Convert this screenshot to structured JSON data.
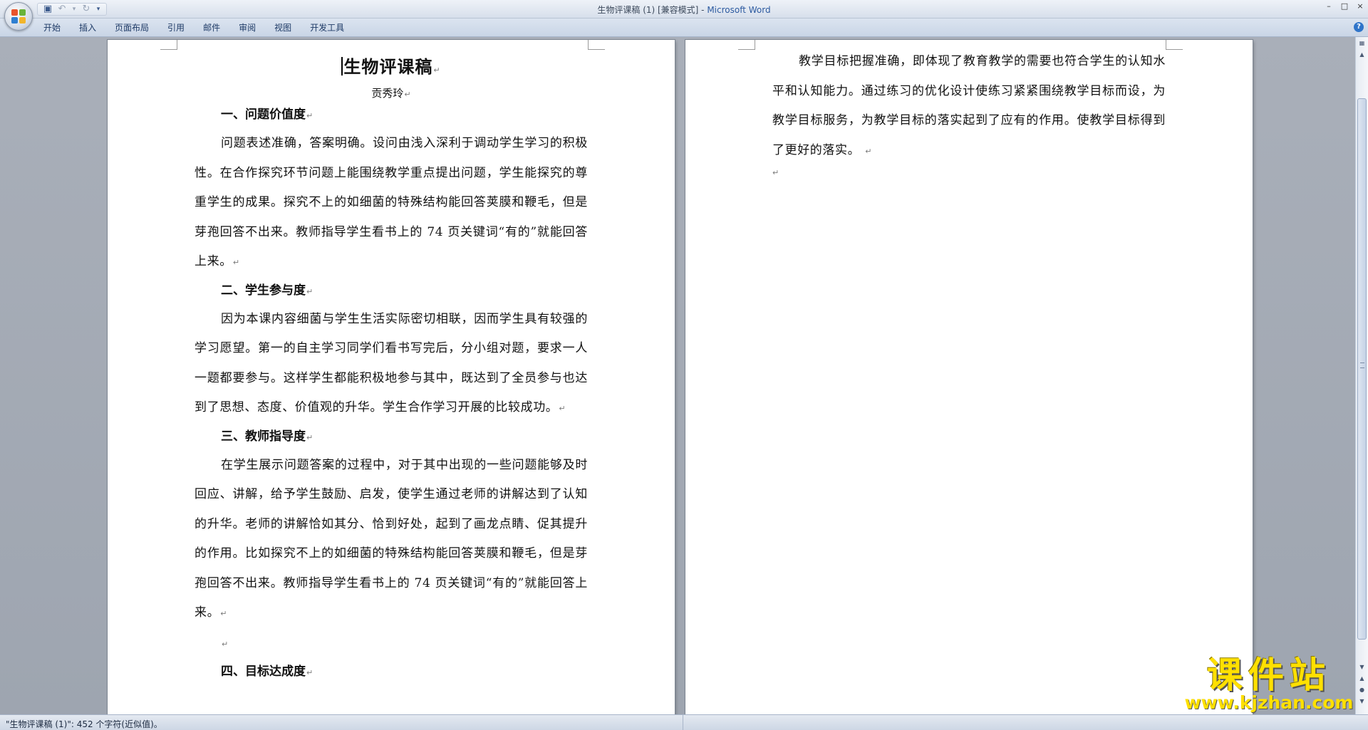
{
  "window": {
    "title": "生物评课稿 (1) [兼容模式] - ",
    "app_name": "Microsoft Word",
    "controls": [
      "–",
      "□",
      "×"
    ]
  },
  "quick_access": {
    "icons": [
      "save-icon",
      "undo-icon",
      "redo-icon",
      "customize-icon"
    ]
  },
  "ribbon": {
    "tabs": [
      "开始",
      "插入",
      "页面布局",
      "引用",
      "邮件",
      "审阅",
      "视图",
      "开发工具"
    ],
    "help": "?"
  },
  "document": {
    "title": "生物评课稿",
    "author": "贡秀玲",
    "paragraph_mark": "↵",
    "sections": [
      {
        "heading": "一、问题价值度",
        "body": "问题表述准确，答案明确。设问由浅入深利于调动学生学习的积极性。在合作探究环节问题上能围绕教学重点提出问题，学生能探究的尊重学生的成果。探究不上的如细菌的特殊结构能回答荚膜和鞭毛，但是芽孢回答不出来。教师指导学生看书上的 74 页关键词“有的”就能回答上来。"
      },
      {
        "heading": "二、学生参与度",
        "body": "因为本课内容细菌与学生生活实际密切相联，因而学生具有较强的学习愿望。第一的自主学习同学们看书写完后，分小组对题，要求一人一题都要参与。这样学生都能积极地参与其中，既达到了全员参与也达到了思想、态度、价值观的升华。学生合作学习开展的比较成功。"
      },
      {
        "heading": "三、教师指导度",
        "body": "在学生展示问题答案的过程中，对于其中出现的一些问题能够及时回应、讲解，给予学生鼓励、启发，使学生通过老师的讲解达到了认知的升华。老师的讲解恰如其分、恰到好处，起到了画龙点睛、促其提升的作用。比如探究不上的如细菌的特殊结构能回答荚膜和鞭毛，但是芽孢回答不出来。教师指导学生看书上的 74 页关键词“有的”就能回答上来。"
      },
      {
        "heading": "四、目标达成度",
        "body": ""
      }
    ],
    "page2_body": "教学目标把握准确，即体现了教育教学的需要也符合学生的认知水平和认知能力。通过练习的优化设计使练习紧紧围绕教学目标而设，为教学目标服务，为教学目标的落实起到了应有的作用。使教学目标得到了更好的落实。"
  },
  "statusbar": {
    "text": "\"生物评课稿 (1)\": 452 个字符(近似值)。"
  },
  "watermark": {
    "main": "课件站",
    "url": "www.kjzhan.com"
  },
  "colors": {
    "ribbon_text": "#1e3a66",
    "app_name": "#2c5aa0",
    "watermark": "#ffe000",
    "workspace": "#a3a9b3"
  }
}
